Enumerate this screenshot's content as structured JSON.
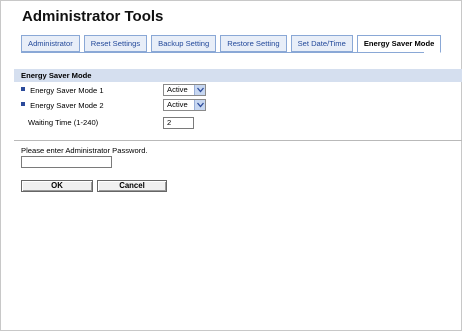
{
  "page": {
    "title": "Administrator Tools"
  },
  "tabs": [
    {
      "label": "Administrator"
    },
    {
      "label": "Reset Settings"
    },
    {
      "label": "Backup Setting"
    },
    {
      "label": "Restore Setting"
    },
    {
      "label": "Set Date/Time"
    },
    {
      "label": "Energy Saver Mode",
      "active": true
    }
  ],
  "section": {
    "heading": "Energy Saver Mode",
    "mode1": {
      "label": "Energy Saver Mode 1",
      "value": "Active"
    },
    "mode2": {
      "label": "Energy Saver Mode 2",
      "value": "Active"
    },
    "waiting": {
      "label": "Waiting Time (1-240)",
      "value": "2"
    }
  },
  "password": {
    "label": "Please enter Administrator Password.",
    "value": ""
  },
  "buttons": {
    "ok": "OK",
    "cancel": "Cancel"
  },
  "colors": {
    "accent": "#2b4a9a",
    "tab_border": "#8aa8d6",
    "section_bg": "#d5dfef"
  }
}
